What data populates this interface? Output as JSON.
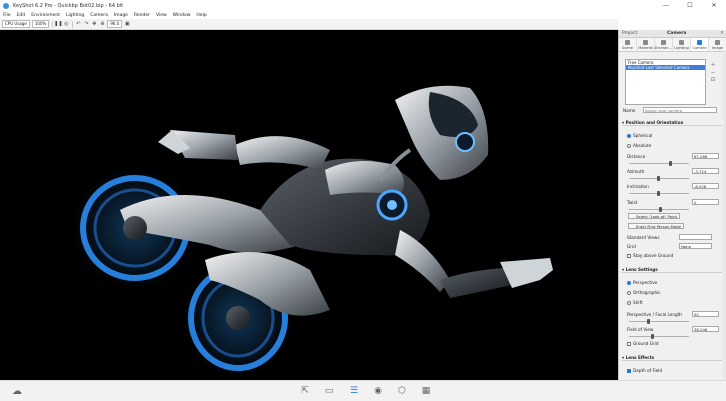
{
  "window": {
    "title": "KeyShot 6.2 Pro - Quickbp Bot02.bip - 64 bit",
    "minimize": "—",
    "maximize": "☐",
    "close": "✕"
  },
  "menu": [
    "File",
    "Edit",
    "Environment",
    "Lighting",
    "Camera",
    "Image",
    "Render",
    "View",
    "Window",
    "Help"
  ],
  "toolbar": {
    "cpu_label": "CPU Usage",
    "cpu_value": "100%",
    "zoom_value": "96.0"
  },
  "panel": {
    "tab_left": "Project",
    "title": "Camera",
    "tabs": [
      "Scene",
      "Material",
      "Environ...",
      "Lighting",
      "Camera",
      "Image"
    ],
    "active_tab": "Camera",
    "cameras": [
      "Free Camera",
      "KeyShot Last Selected Camera"
    ],
    "name_label": "Name",
    "name_placeholder": "Adjust your camera",
    "position_section": "Position and Orientation",
    "spherical": "Spherical",
    "absolute": "Absolute",
    "distance_label": "Distance",
    "distance_value": "67.266",
    "azimuth_label": "Azimuth",
    "azimuth_value": "-3.724",
    "inclination_label": "Inclination",
    "inclination_value": "-8.028",
    "twist_label": "Twist",
    "twist_value": "0",
    "lookat_button": "Select \"Look at\" Point",
    "firstperson_button": "Enter First Person Mode",
    "standard_views_label": "Standard Views",
    "grid_label": "Grid",
    "grid_value": "None",
    "stay_above": "Stay above Ground",
    "lens_section": "Lens Settings",
    "perspective": "Perspective",
    "orthographic": "Orthographic",
    "shift": "Shift",
    "focal_label": "Perspective / Focal Length",
    "focal_value": "50",
    "fov_label": "Field of View",
    "fov_value": "36.246",
    "ground_grid": "Ground Grid",
    "effects_section": "Lens Effects",
    "dof": "Depth of Field"
  },
  "bottom": {
    "buttons": [
      "import",
      "library",
      "project",
      "animation",
      "keyshotvr",
      "render"
    ],
    "active": "project"
  }
}
